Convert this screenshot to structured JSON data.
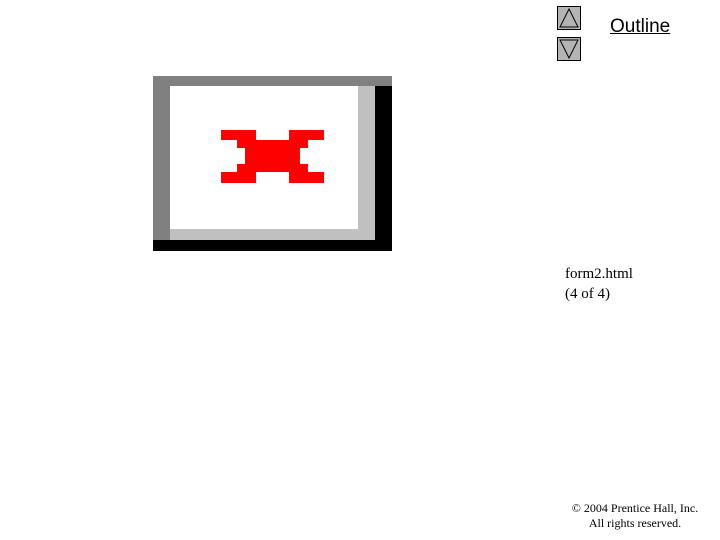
{
  "nav": {
    "up_icon": "triangle-up-icon",
    "down_icon": "triangle-down-icon",
    "outline_label": "Outline"
  },
  "image": {
    "state": "broken-image",
    "icon": "red-x-icon",
    "icon_color": "#ff0000",
    "frame_colors": {
      "dark": "#808080",
      "light": "#c0c0c0",
      "shadow": "#000000",
      "face": "#ffffff"
    }
  },
  "caption": {
    "filename": "form2.html",
    "page": "(4 of 4)"
  },
  "footer": {
    "copyright_line1": "© 2004 Prentice Hall, Inc.",
    "copyright_line2": "All rights reserved."
  }
}
